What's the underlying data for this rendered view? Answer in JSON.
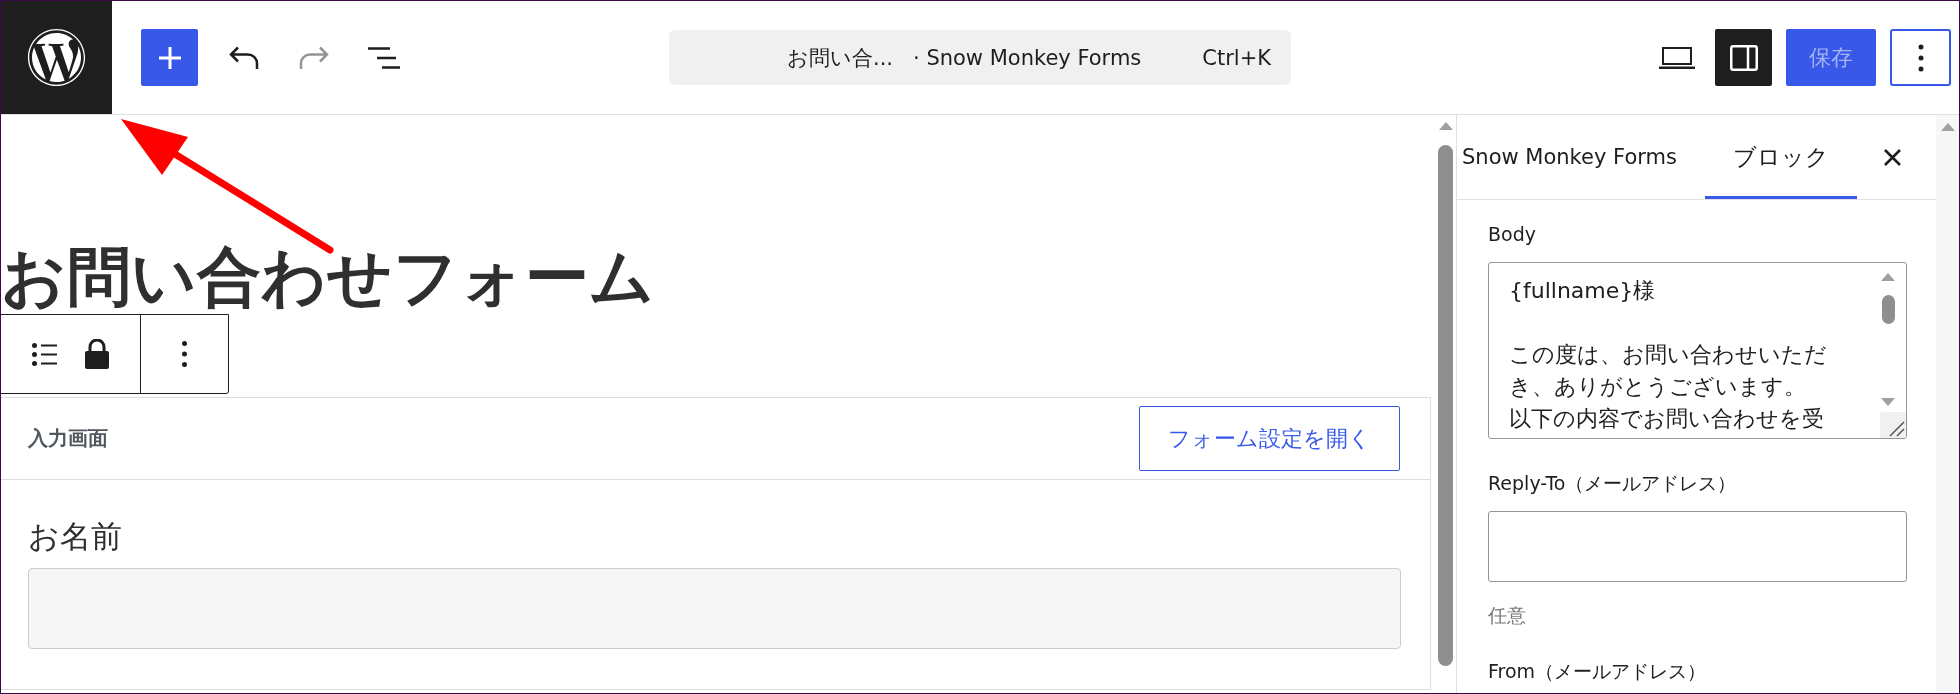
{
  "top_bar": {
    "undo": {
      "disabled": false
    },
    "redo": {
      "disabled": true
    },
    "command_bar": {
      "page_title": "お問い合...",
      "site_name": "· Snow Monkey Forms",
      "shortcut": "Ctrl+K"
    },
    "settings_toggle": {
      "pressed": true
    },
    "save_button": {
      "label": "保存",
      "disabled": true
    }
  },
  "canvas": {
    "page_title": "お問い合わせフォーム",
    "form_block": {
      "header_label": "入力画面",
      "settings_button": "フォーム設定を開く",
      "fields": [
        {
          "label": "お名前"
        }
      ]
    }
  },
  "sidebar": {
    "tabs": [
      {
        "label": "Snow Monkey Forms",
        "selected": false
      },
      {
        "label": "ブロック",
        "selected": true
      }
    ],
    "fields": [
      {
        "kind": "textarea",
        "label": "Body",
        "paragraphs": [
          [
            "{fullname}様"
          ],
          [
            "この度は、お問い合わせいただき、ありがとうございます。",
            "以下の内容でお問い合わせを受"
          ]
        ]
      },
      {
        "kind": "input",
        "label": "Reply-To（メールアドレス）",
        "help": "任意"
      },
      {
        "kind": "label",
        "label": "From（メールアドレス）"
      }
    ]
  }
}
